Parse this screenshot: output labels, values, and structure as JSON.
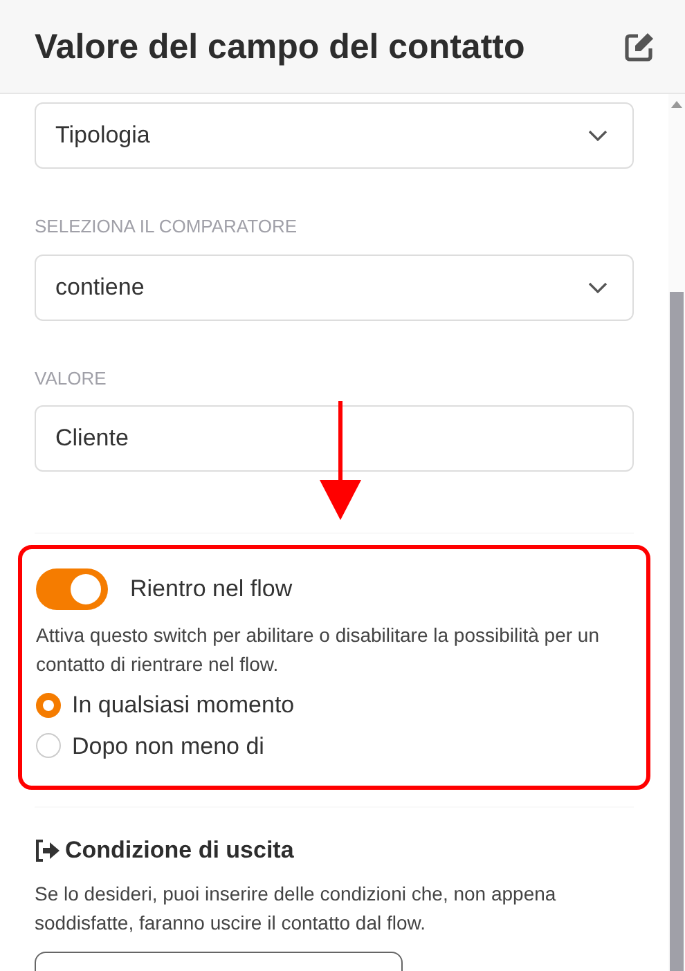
{
  "header": {
    "title": "Valore del campo del contatto"
  },
  "fields": [
    {
      "kind": "select",
      "value": "Tipologia"
    },
    {
      "kind": "select",
      "label": "SELEZIONA IL COMPARATORE",
      "value": "contiene"
    },
    {
      "kind": "text",
      "label": "VALORE",
      "value": "Cliente"
    }
  ],
  "reentry": {
    "label": "Rientro nel flow",
    "on": true,
    "description": "Attiva questo switch per abilitare o disabilitare la possibilità per un contatto di rientrare nel flow.",
    "options": [
      {
        "label": "In qualsiasi momento",
        "selected": true
      },
      {
        "label": "Dopo non meno di",
        "selected": false
      }
    ]
  },
  "exit": {
    "title": "Condizione di uscita",
    "description": "Se lo desideri, puoi inserire delle condizioni che, non appena soddisfatte, faranno uscire il contatto dal flow."
  }
}
